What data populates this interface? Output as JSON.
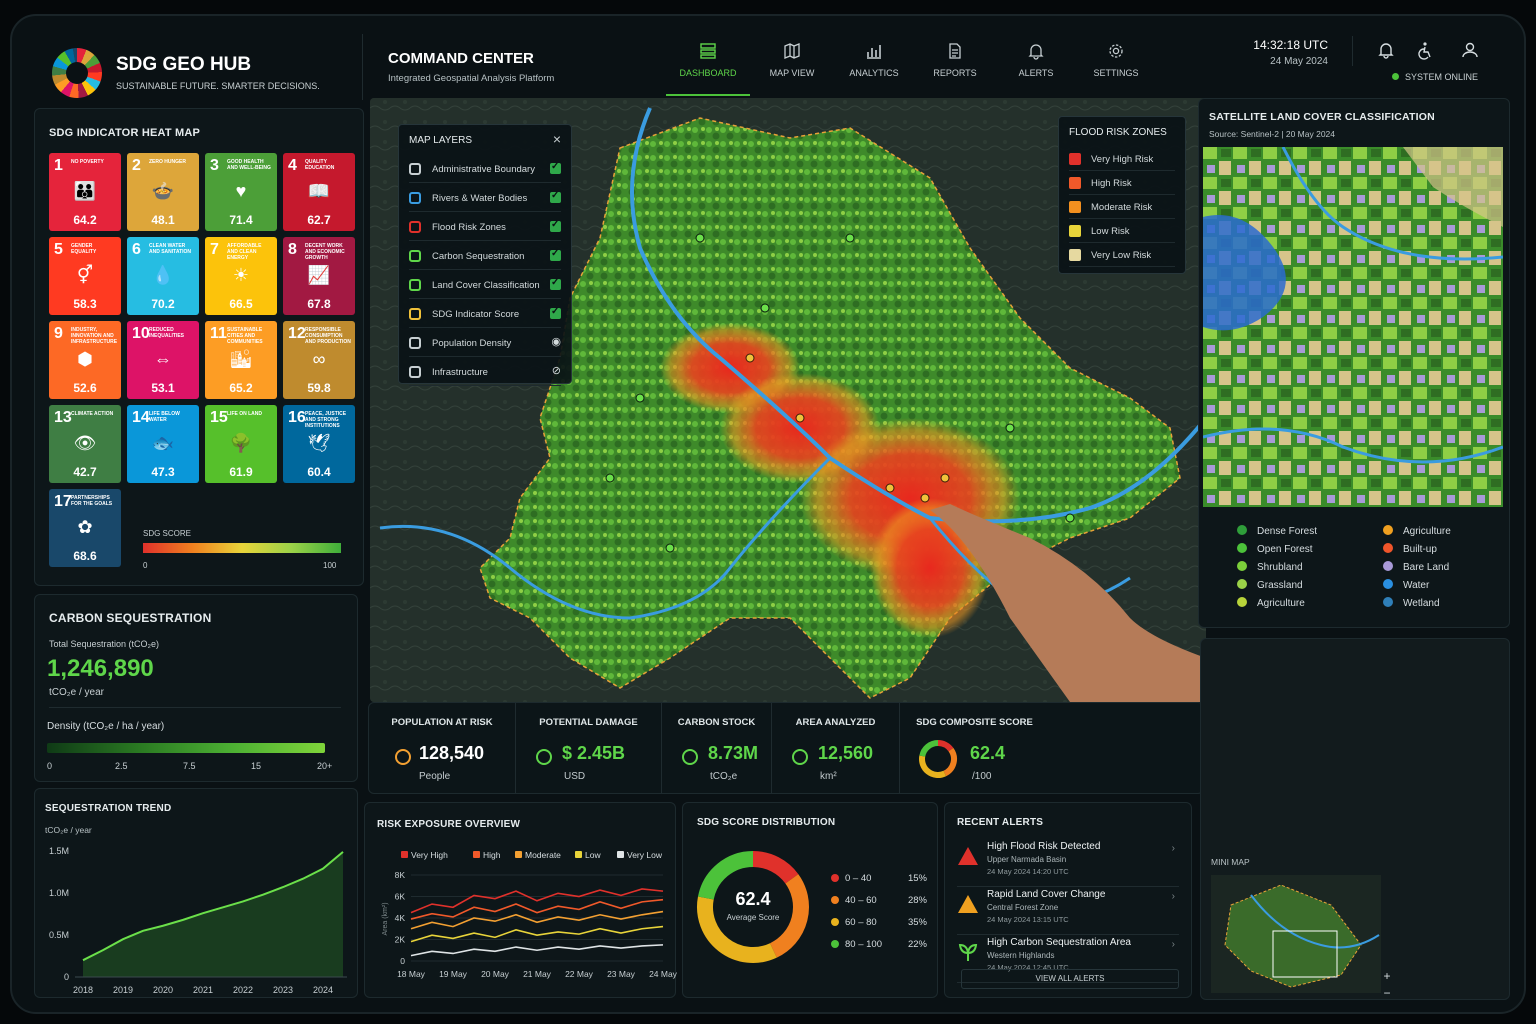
{
  "header": {
    "brand_title": "SDG GEO HUB",
    "brand_subtitle": "SUSTAINABLE FUTURE. SMARTER DECISIONS.",
    "section_title": "COMMAND CENTER",
    "section_subtitle": "Integrated Geospatial Analysis Platform",
    "nav": [
      {
        "label": "DASHBOARD",
        "icon": "dashboard-icon"
      },
      {
        "label": "MAP VIEW",
        "icon": "map-icon"
      },
      {
        "label": "ANALYTICS",
        "icon": "analytics-icon"
      },
      {
        "label": "REPORTS",
        "icon": "reports-icon"
      },
      {
        "label": "ALERTS",
        "icon": "bell-icon"
      },
      {
        "label": "SETTINGS",
        "icon": "gear-icon"
      }
    ],
    "time": "14:32:18 UTC",
    "date": "24 May 2024",
    "status": "SYSTEM ONLINE",
    "colors": {
      "accent": "#5fd64a",
      "bg": "#0a1114"
    }
  },
  "sdg_heatmap": {
    "title": "SDG INDICATOR HEAT MAP",
    "goals": [
      {
        "n": "1",
        "label": "NO POVERTY",
        "value": "64.2",
        "color": "#e5243b",
        "icon": "👪"
      },
      {
        "n": "2",
        "label": "ZERO HUNGER",
        "value": "48.1",
        "color": "#dda63a",
        "icon": "🍲"
      },
      {
        "n": "3",
        "label": "GOOD HEALTH AND WELL-BEING",
        "value": "71.4",
        "color": "#4c9f38",
        "icon": "♥"
      },
      {
        "n": "4",
        "label": "QUALITY EDUCATION",
        "value": "62.7",
        "color": "#c5192d",
        "icon": "📖"
      },
      {
        "n": "5",
        "label": "GENDER EQUALITY",
        "value": "58.3",
        "color": "#ff3a21",
        "icon": "⚥"
      },
      {
        "n": "6",
        "label": "CLEAN WATER AND SANITATION",
        "value": "70.2",
        "color": "#26bde2",
        "icon": "💧"
      },
      {
        "n": "7",
        "label": "AFFORDABLE AND CLEAN ENERGY",
        "value": "66.5",
        "color": "#fcc30b",
        "icon": "☀"
      },
      {
        "n": "8",
        "label": "DECENT WORK AND ECONOMIC GROWTH",
        "value": "67.8",
        "color": "#a21942",
        "icon": "📈"
      },
      {
        "n": "9",
        "label": "INDUSTRY, INNOVATION AND INFRASTRUCTURE",
        "value": "52.6",
        "color": "#fd6925",
        "icon": "⬢"
      },
      {
        "n": "10",
        "label": "REDUCED INEQUALITIES",
        "value": "53.1",
        "color": "#dd1367",
        "icon": "⇔"
      },
      {
        "n": "11",
        "label": "SUSTAINABLE CITIES AND COMMUNITIES",
        "value": "65.2",
        "color": "#fd9d24",
        "icon": "🏙"
      },
      {
        "n": "12",
        "label": "RESPONSIBLE CONSUMPTION AND PRODUCTION",
        "value": "59.8",
        "color": "#bf8b2e",
        "icon": "∞"
      },
      {
        "n": "13",
        "label": "CLIMATE ACTION",
        "value": "42.7",
        "color": "#3f7e44",
        "icon": "👁"
      },
      {
        "n": "14",
        "label": "LIFE BELOW WATER",
        "value": "47.3",
        "color": "#0a97d9",
        "icon": "🐟"
      },
      {
        "n": "15",
        "label": "LIFE ON LAND",
        "value": "61.9",
        "color": "#56c02b",
        "icon": "🌳"
      },
      {
        "n": "16",
        "label": "PEACE, JUSTICE AND STRONG INSTITUTIONS",
        "value": "60.4",
        "color": "#00689d",
        "icon": "🕊"
      },
      {
        "n": "17",
        "label": "PARTNERSHIPS FOR THE GOALS",
        "value": "68.6",
        "color": "#19486a",
        "icon": "✿"
      }
    ],
    "score_label": "SDG SCORE",
    "scale_min": "0",
    "scale_max": "100"
  },
  "carbon": {
    "title": "CARBON SEQUESTRATION",
    "total_label": "Total Sequestration (tCO₂e)",
    "total_value": "1,246,890",
    "total_unit": "tCO₂e / year",
    "density_label": "Density (tCO₂e / ha / year)",
    "density_ticks": [
      "0",
      "2.5",
      "7.5",
      "15",
      "20+"
    ]
  },
  "trend": {
    "title": "SEQUESTRATION TREND",
    "unit": "tCO₂e / year",
    "y_ticks": [
      "1.5M",
      "1.0M",
      "0.5M",
      "0"
    ],
    "x_ticks": [
      "2018",
      "2019",
      "2020",
      "2021",
      "2022",
      "2023",
      "2024"
    ]
  },
  "map_layers": {
    "title": "MAP LAYERS",
    "items": [
      {
        "label": "Administrative Boundary",
        "icon": "boundary-icon",
        "state": "checked"
      },
      {
        "label": "Rivers & Water Bodies",
        "icon": "water-icon",
        "state": "checked"
      },
      {
        "label": "Flood Risk Zones",
        "icon": "flood-icon",
        "state": "checked"
      },
      {
        "label": "Carbon Sequestration",
        "icon": "leaf-icon",
        "state": "checked"
      },
      {
        "label": "Land Cover Classification",
        "icon": "landcover-icon",
        "state": "checked"
      },
      {
        "label": "SDG Indicator Score",
        "icon": "sdg-icon",
        "state": "checked"
      },
      {
        "label": "Population Density",
        "icon": "population-icon",
        "state": "eye"
      },
      {
        "label": "Infrastructure",
        "icon": "infrastructure-icon",
        "state": "eye-off"
      }
    ]
  },
  "flood_zones": {
    "title": "FLOOD RISK ZONES",
    "items": [
      {
        "label": "Very High Risk",
        "color": "#e0312b"
      },
      {
        "label": "High Risk",
        "color": "#f0592a"
      },
      {
        "label": "Moderate Risk",
        "color": "#f3901f"
      },
      {
        "label": "Low Risk",
        "color": "#e8d43a"
      },
      {
        "label": "Very Low Risk",
        "color": "#e6d9a0"
      }
    ]
  },
  "kpis": [
    {
      "label": "POPULATION AT RISK",
      "value": "128,540",
      "unit": "People",
      "icon": "people-icon",
      "color": "#f3a032"
    },
    {
      "label": "POTENTIAL DAMAGE",
      "value": "$ 2.45B",
      "unit": "USD",
      "icon": "damage-icon",
      "color": "#5fd64a"
    },
    {
      "label": "CARBON STOCK",
      "value": "8.73M",
      "unit": "tCO₂e",
      "icon": "leaf-icon",
      "color": "#5fd64a"
    },
    {
      "label": "AREA ANALYZED",
      "value": "12,560",
      "unit": "km²",
      "icon": "area-icon",
      "color": "#5fd64a"
    },
    {
      "label": "SDG COMPOSITE SCORE",
      "value": "62.4",
      "unit": "/100",
      "icon": "ring-icon",
      "color": "#5fd64a"
    }
  ],
  "satellite": {
    "title": "SATELLITE LAND COVER CLASSIFICATION",
    "source": "Source: Sentinel-2  |  20 May 2024",
    "legend": [
      {
        "label": "Dense Forest",
        "color": "#2f9e3a"
      },
      {
        "label": "Open Forest",
        "color": "#4cc23a"
      },
      {
        "label": "Shrubland",
        "color": "#7ccf3a"
      },
      {
        "label": "Grassland",
        "color": "#9bd248"
      },
      {
        "label": "Agriculture",
        "color": "#b8d43a"
      },
      {
        "label": "Agriculture",
        "color": "#f0a020"
      },
      {
        "label": "Built-up",
        "color": "#f0552a"
      },
      {
        "label": "Bare Land",
        "color": "#a99ad8"
      },
      {
        "label": "Water",
        "color": "#2a8fe0"
      },
      {
        "label": "Wetland",
        "color": "#2f7fb8"
      }
    ]
  },
  "risk_exposure": {
    "title": "RISK EXPOSURE OVERVIEW",
    "y_label": "Area (km²)"
  },
  "sdg_dist": {
    "title": "SDG SCORE DISTRIBUTION",
    "center_value": "62.4",
    "center_label": "Average Score"
  },
  "alerts": {
    "title": "RECENT ALERTS",
    "items": [
      {
        "title": "High Flood Risk Detected",
        "place": "Upper Narmada Basin",
        "time": "24 May 2024 14:20 UTC",
        "icon": "warning-red-icon"
      },
      {
        "title": "Rapid Land Cover Change",
        "place": "Central Forest Zone",
        "time": "24 May 2024 13:15 UTC",
        "icon": "warning-orange-icon"
      },
      {
        "title": "High Carbon Sequestration Area",
        "place": "Western Highlands",
        "time": "24 May 2024 12:45 UTC",
        "icon": "sprout-icon"
      }
    ],
    "view_all": "VIEW ALL ALERTS"
  },
  "minimap": {
    "title": "MINI MAP",
    "zoom_in": "+",
    "zoom_out": "−"
  },
  "chart_data": [
    {
      "type": "line",
      "title": "SEQUESTRATION TREND",
      "ylabel": "tCO₂e / year",
      "x": [
        2018,
        2018.5,
        2019,
        2019.5,
        2020,
        2020.5,
        2021,
        2021.5,
        2022,
        2022.5,
        2023,
        2023.5,
        2024,
        2024.5
      ],
      "series": [
        {
          "values": [
            200000,
            320000,
            450000,
            550000,
            610000,
            680000,
            760000,
            830000,
            900000,
            980000,
            1070000,
            1170000,
            1290000,
            1490000
          ]
        }
      ],
      "xlim": [
        2017.8,
        2024.6
      ],
      "ylim": [
        0,
        1500000
      ],
      "grid": false
    },
    {
      "type": "line",
      "title": "RISK EXPOSURE OVERVIEW",
      "ylabel": "Area (km²)",
      "categories": [
        "18 May",
        "19 May",
        "20 May",
        "21 May",
        "22 May",
        "23 May",
        "24 May"
      ],
      "x": [
        0,
        0.5,
        1,
        1.5,
        2,
        2.5,
        3,
        3.5,
        4,
        4.5,
        5,
        5.5,
        6
      ],
      "series": [
        {
          "name": "Very High",
          "color": "#e0312b",
          "values": [
            4500,
            5300,
            5000,
            6100,
            5800,
            6500,
            5600,
            6300,
            6000,
            6600,
            6100,
            6700,
            6500
          ]
        },
        {
          "name": "High",
          "color": "#f0592a",
          "values": [
            3900,
            4400,
            4100,
            5000,
            4600,
            5300,
            4500,
            5100,
            4800,
            5500,
            4900,
            5500,
            5700
          ]
        },
        {
          "name": "Moderate",
          "color": "#f3a032",
          "values": [
            3000,
            3600,
            3200,
            4000,
            3700,
            4300,
            3600,
            4100,
            3800,
            4300,
            3900,
            4300,
            4600
          ]
        },
        {
          "name": "Low",
          "color": "#e8d43a",
          "values": [
            1800,
            2400,
            2100,
            2600,
            2200,
            2900,
            2400,
            2700,
            2500,
            3000,
            2600,
            3000,
            3200
          ]
        },
        {
          "name": "Very Low",
          "color": "#dfe4e6",
          "values": [
            500,
            900,
            700,
            1100,
            900,
            1300,
            1000,
            1300,
            1100,
            1400,
            1200,
            1400,
            1500
          ]
        }
      ],
      "y_ticks": [
        "0",
        "2K",
        "4K",
        "6K",
        "8K"
      ],
      "ylim": [
        0,
        8000
      ],
      "legend": "top",
      "grid": true
    },
    {
      "type": "pie",
      "title": "SDG SCORE DISTRIBUTION",
      "slices": [
        {
          "label": "0 – 40",
          "value": 15,
          "display": "15%",
          "color": "#e0312b"
        },
        {
          "label": "40 – 60",
          "value": 28,
          "display": "28%",
          "color": "#f0801f"
        },
        {
          "label": "60 – 80",
          "value": 35,
          "display": "35%",
          "color": "#e8b21e"
        },
        {
          "label": "80 – 100",
          "value": 22,
          "display": "22%",
          "color": "#4cc23a"
        }
      ]
    }
  ]
}
